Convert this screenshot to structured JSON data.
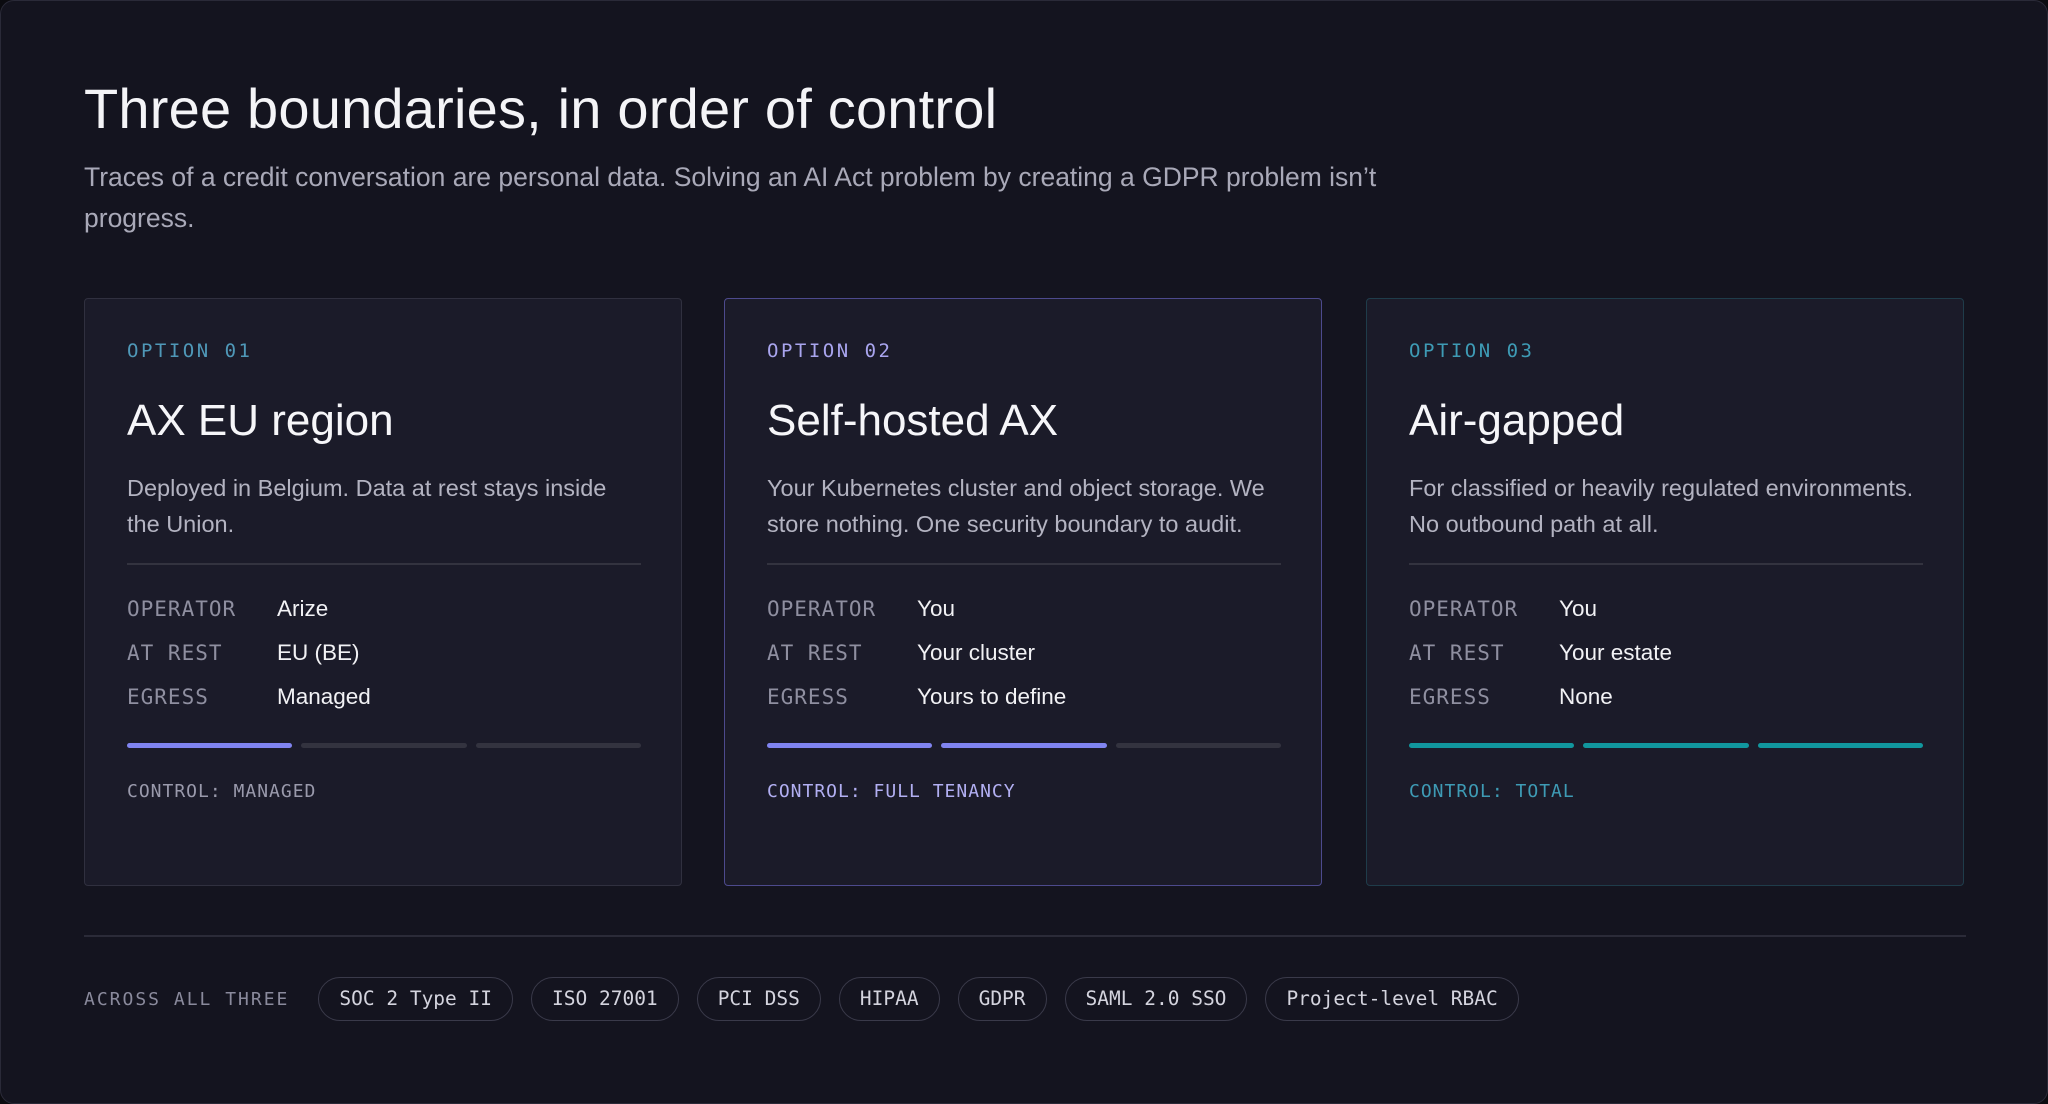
{
  "page": {
    "title": "Three boundaries, in order of control",
    "subtitle": "Traces of a credit conversation are personal data. Solving an AI Act problem by creating a GDPR problem isn’t progress."
  },
  "options": [
    {
      "tag": "OPTION 01",
      "title": "AX EU region",
      "description": "Deployed in Belgium. Data at rest stays inside the Union.",
      "rows": [
        {
          "key": "OPERATOR",
          "value": "Arize"
        },
        {
          "key": "AT REST",
          "value": "EU (BE)"
        },
        {
          "key": "EGRESS",
          "value": "Managed"
        }
      ],
      "control_level": "1 of 3",
      "control": "CONTROL: MANAGED",
      "accent": "#8084f0"
    },
    {
      "tag": "OPTION 02",
      "title": "Self-hosted AX",
      "description": "Your Kubernetes cluster and object storage. We store nothing. One security boundary to audit.",
      "rows": [
        {
          "key": "OPERATOR",
          "value": "You"
        },
        {
          "key": "AT REST",
          "value": "Your cluster"
        },
        {
          "key": "EGRESS",
          "value": "Yours to define"
        }
      ],
      "control_level": "2 of 3",
      "control": "CONTROL: FULL TENANCY",
      "accent": "#8084f0"
    },
    {
      "tag": "OPTION 03",
      "title": "Air-gapped",
      "description": "For classified or heavily regulated environments. No outbound path at all.",
      "rows": [
        {
          "key": "OPERATOR",
          "value": "You"
        },
        {
          "key": "AT REST",
          "value": "Your estate"
        },
        {
          "key": "EGRESS",
          "value": "None"
        }
      ],
      "control_level": "3 of 3",
      "control": "CONTROL: TOTAL",
      "accent": "#11979e"
    }
  ],
  "footer": {
    "label": "ACROSS ALL THREE",
    "chips": [
      "SOC 2 Type II",
      "ISO 27001",
      "PCI DSS",
      "HIPAA",
      "GDPR",
      "SAML 2.0 SSO",
      "Project-level RBAC"
    ]
  },
  "colors": {
    "background": "#14141f",
    "card": "#1b1b29",
    "indigo_accent": "#8084f0",
    "teal_accent": "#11979e",
    "option_02_border": "#4d4a8d",
    "option_03_border": "#1f3c4a"
  }
}
